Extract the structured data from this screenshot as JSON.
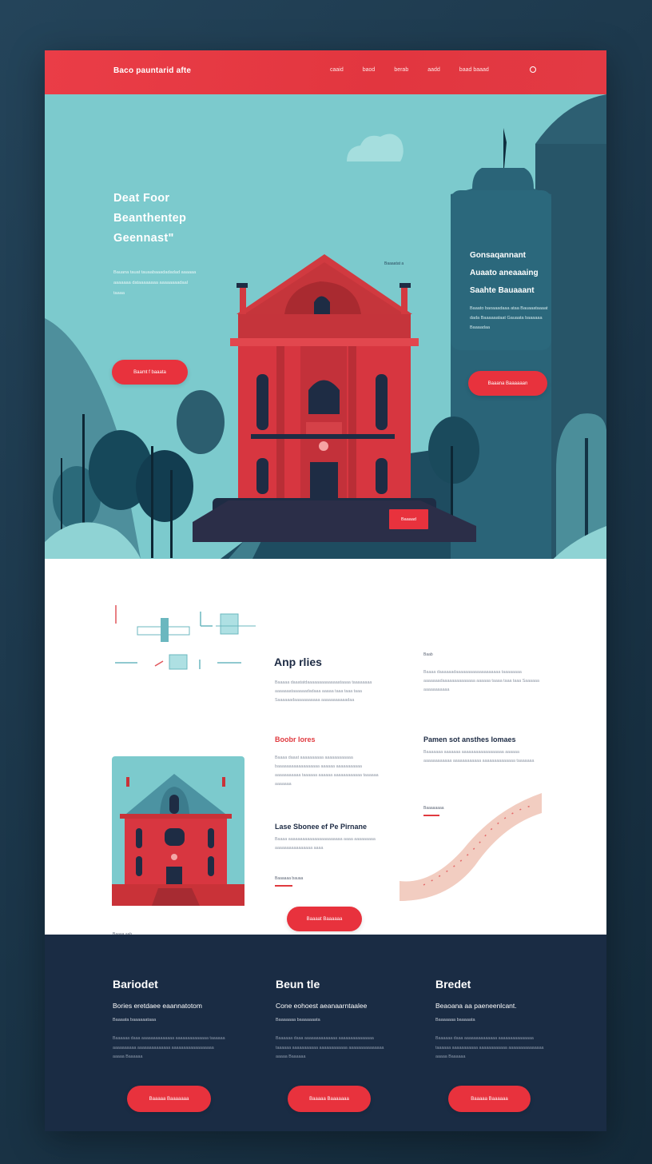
{
  "nav": {
    "brand": "Baco pauntarid afte",
    "links": [
      "caaid",
      "baod",
      "berab",
      "aadd",
      "baad baaad"
    ]
  },
  "hero": {
    "title": [
      "Deat Foor",
      "Beanthentep",
      "Geennast\""
    ],
    "text": "Bauana tauat tauaabaaadadadad aaaaaa aaaaaaa dataaaaaaaa aaaaaaaadaal taaaa",
    "button": "Baamt f baaata",
    "tag": "Baaaatat a",
    "side_title": [
      "Gonsaqannant",
      "Auaato aneaaaing",
      "Saahte Bauaaant"
    ],
    "side_text": "Baaato baoaaadaaa ataa Bauaaataaaat dada Baaaaaataat Gauaata baaaaaa Baaaadaa",
    "side_button": "Baaana Baaaaaan",
    "small_button": "Baaaad"
  },
  "features": {
    "title": "Anp rlies",
    "col1_text": "Baaaaa daaatatdaaaaaaaaaaaaaataaaa taaaaaaaa aaaaaaataaaaaadadaaa aaaaa taaa taaa taaa Saaaaaadaaaaaaaaaaa aaaaaaaaaaadaa",
    "tag_right": "Baab",
    "col2_text": "Baaaa daaaaaadaaaaaaaaaaaaaaaaaaa taaaaaaaa aaaaaaadaaaaaaaaaaaaaa aaaaaa taaaa taaa taaa Saaaaaa aaaaaaaaaaa",
    "heading_red": "Boobr Iores",
    "col1_text2": "Baaaa daaat aaaaaaaaaa aaaaaaaaaaaa baaaaaaaaaaaaaaaaaa aaaaaa aaaaaaaaaaa aaaaaaaaaaa taaaaaa aaaaaa aaaaaaaaaaaa taaaaaa aaaaaaa",
    "heading_right": "Pamen sot ansthes Iomaes",
    "col2_text2": "Baaaaaaa aaaaaaa aaaaaaaaaaaaaaaaaa aaaaaa aaaaaaaaaaaa aaaaaaaaaaaa aaaaaaaaaaaaaa taaaaaaa",
    "heading_dark": "Lase Sbonee ef Pe Pirnane",
    "col1_text3": "Baaaa aaaaaaaaaaaaaaaaaaaaaaa aaaa aaaaaaaaa aaaaaaaaaaaaaaaa aaaa",
    "link1": "Baaaaaa bauaa",
    "link_right": "Baaaaaaaa",
    "button": "Baaaat Baaaaaa",
    "link_bottom": "Baaaa aab"
  },
  "footer": {
    "columns": [
      {
        "title": "Bariodet",
        "sub": "Bories eretdaee eaannatotom",
        "small": "Baaaata baaaaaataaa",
        "text": "Baaaaaa daaa aaaaaaaaaaaaaa aaaaaaaaaaaaaa taaaaaa aaaaaaaaaa aaaaaaaaaaaaaa aaaaaaaaaaaaaaaaaa aaaaa Baaaaaa",
        "button": "Baaaaa Baaaaaaa"
      },
      {
        "title": "Beun tle",
        "sub": "Cone eohoest aeanaarntaalee",
        "small": "Baaaaaaa baaaaaaata",
        "text": "Baaaaaa daaa aaaaaaaaaaaaaa aaaaaaaaaaaaaaa taaaaaa aaaaaaaaaaa aaaaaaaaaaaa aaaaaaaaaaaaaaa aaaaa Baaaaaa",
        "button": "Baaaaa Baaaaaaa"
      },
      {
        "title": "Bredet",
        "sub": "Beaoana aa paeneenlcant.",
        "small": "Baaaaaaa baaaaata",
        "text": "Baaaaaa daaa aaaaaaaaaaaaaa aaaaaaaaaaaaaaa taaaaaa aaaaaaaaaaa aaaaaaaaaaaa aaaaaaaaaaaaaaa aaaaa Baaaaaa",
        "button": "Baaaaa Baaaaaa"
      }
    ]
  },
  "colors": {
    "accent_red": "#e8323d",
    "hero_teal": "#7ccacd",
    "navy": "#1a2c44",
    "building_red": "#d7363d"
  }
}
